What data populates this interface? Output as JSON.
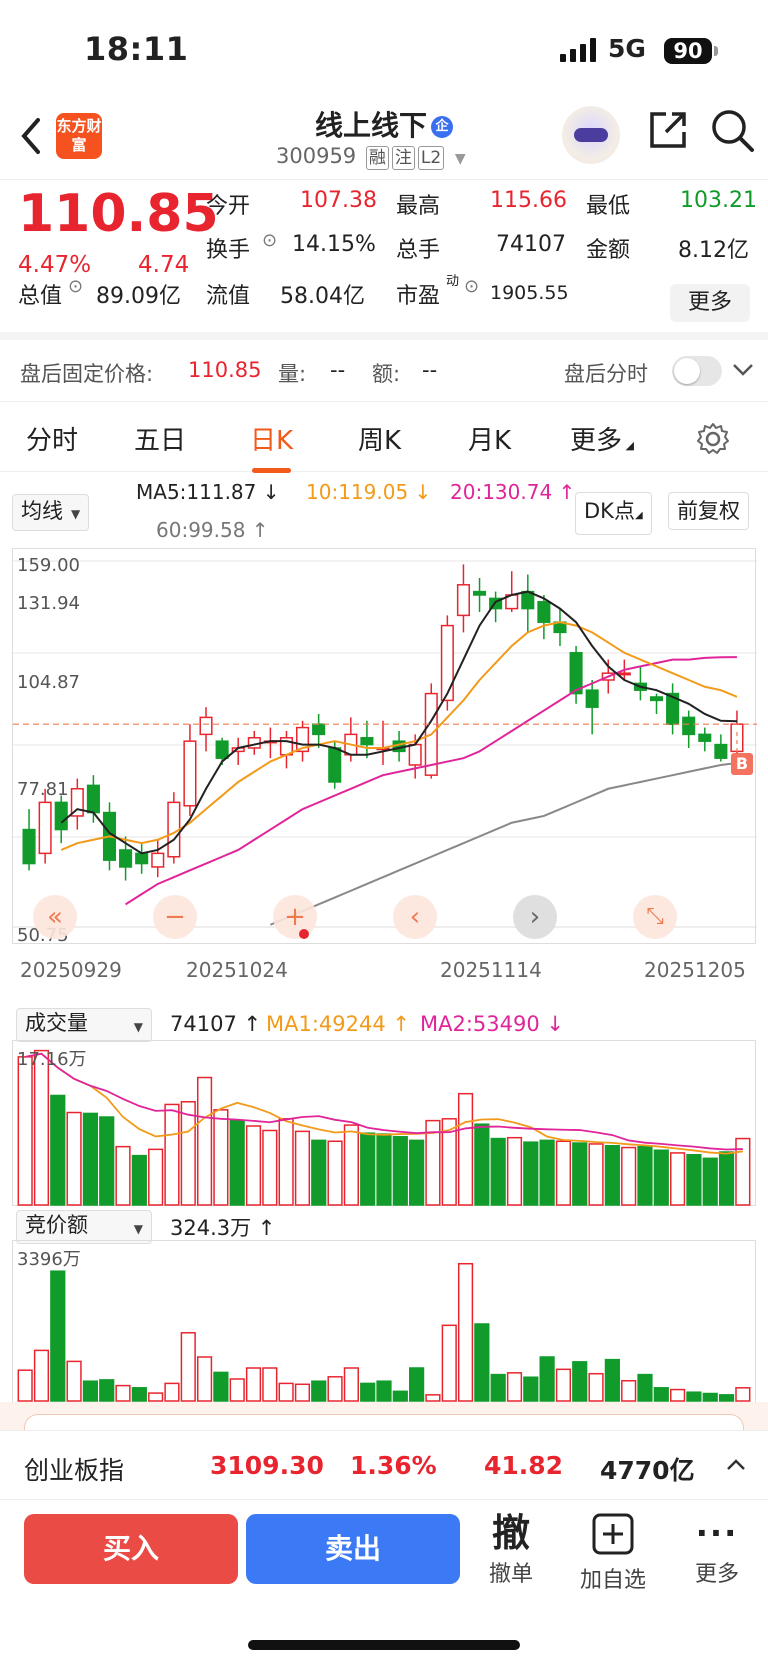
{
  "status_bar": {
    "time": "18:11",
    "network": "5G",
    "battery": "90"
  },
  "header": {
    "logo_text": "东方财富",
    "stock_name": "线上线下",
    "badge": "企",
    "code": "300959",
    "tags": [
      "融",
      "注",
      "L2"
    ]
  },
  "quote": {
    "price": "110.85",
    "change_pct": "4.47%",
    "change_abs": "4.74",
    "open_label": "今开",
    "open": "107.38",
    "high_label": "最高",
    "high": "115.66",
    "low_label": "最低",
    "low": "103.21",
    "turnover_label": "换手",
    "turnover": "14.15%",
    "volume_label": "总手",
    "volume": "74107",
    "amount_label": "金额",
    "amount": "8.12亿",
    "mktcap_label": "总值",
    "mktcap": "89.09亿",
    "float_label": "流值",
    "float_cap": "58.04亿",
    "pe_label": "市盈",
    "pe_sup": "动",
    "pe": "1905.55",
    "more_label": "更多"
  },
  "after_hours": {
    "label": "盘后固定价格:",
    "price": "110.85",
    "vol_label": "量:",
    "vol": "--",
    "amt_label": "额:",
    "amt": "--",
    "toggle_label": "盘后分时"
  },
  "tabs": [
    "分时",
    "五日",
    "日K",
    "周K",
    "月K",
    "更多"
  ],
  "active_tab": "日K",
  "kline": {
    "indicator_select": "均线",
    "ma5": "MA5:111.87",
    "ma10": "10:119.05",
    "ma20": "20:130.74",
    "ma60": "60:99.58",
    "dk_button": "DK点",
    "adjust_button": "前复权",
    "y_labels": [
      "159.00",
      "131.94",
      "104.87",
      "77.81",
      "50.75"
    ],
    "dates": [
      "20250929",
      "20251024",
      "20251114",
      "20251205"
    ],
    "b_marker": "B",
    "colors": {
      "up": "#e8252f",
      "down": "#119b2b",
      "ma5": "#222222",
      "ma10": "#f29a1a",
      "ma20": "#e0259a",
      "ma60": "#888888"
    }
  },
  "chart_data": [
    {
      "type": "candlestick",
      "ylim": [
        50.75,
        159.0
      ],
      "dates_shown": [
        "20250929",
        "20251024",
        "20251114",
        "20251205"
      ],
      "candles": [
        [
          80,
          70,
          86,
          68
        ],
        [
          73,
          88,
          92,
          70
        ],
        [
          88,
          80,
          90,
          76
        ],
        [
          84,
          92,
          95,
          80
        ],
        [
          93,
          85,
          96,
          82
        ],
        [
          85,
          71,
          88,
          68
        ],
        [
          74,
          69,
          78,
          65
        ],
        [
          73,
          70,
          76,
          67
        ],
        [
          69,
          73,
          77,
          66
        ],
        [
          72,
          88,
          91,
          70
        ],
        [
          87,
          106,
          111,
          84
        ],
        [
          108,
          113,
          116,
          103
        ],
        [
          106,
          101,
          107,
          99
        ],
        [
          103,
          104,
          107,
          99
        ],
        [
          104,
          107,
          109,
          102
        ],
        [
          106,
          106,
          110,
          101
        ],
        [
          102,
          107,
          109,
          98
        ],
        [
          103,
          110,
          112,
          100
        ],
        [
          111,
          108,
          114,
          104
        ],
        [
          104,
          94,
          106,
          92
        ],
        [
          102,
          108,
          113,
          100
        ],
        [
          107,
          105,
          112,
          101
        ],
        [
          104,
          104,
          112,
          99
        ],
        [
          106,
          103,
          109,
          100
        ],
        [
          99,
          105,
          108,
          95
        ],
        [
          96,
          120,
          123,
          95
        ],
        [
          118,
          140,
          143,
          115
        ],
        [
          143,
          152,
          158,
          138
        ],
        [
          150,
          149,
          154,
          144
        ],
        [
          148,
          145,
          150,
          141
        ],
        [
          145,
          149,
          156,
          144
        ],
        [
          150,
          145,
          155,
          138
        ],
        [
          147,
          141,
          149,
          136
        ],
        [
          141,
          138,
          145,
          134
        ],
        [
          132,
          120,
          134,
          117
        ],
        [
          121,
          116,
          124,
          108
        ],
        [
          124,
          126,
          130,
          120
        ],
        [
          126,
          126,
          130,
          124
        ],
        [
          123,
          121,
          128,
          118
        ],
        [
          119,
          118,
          120,
          114
        ],
        [
          120,
          111,
          123,
          108
        ],
        [
          113,
          108,
          115,
          104
        ],
        [
          108,
          106,
          110,
          103
        ],
        [
          105,
          101,
          108,
          100
        ],
        [
          103,
          111,
          115,
          97
        ]
      ],
      "ma5": [
        82,
        86,
        85,
        79,
        76,
        73,
        74,
        77,
        83,
        92,
        100,
        104,
        105,
        106,
        106,
        105,
        105,
        104,
        102,
        102,
        103,
        104,
        105,
        112,
        120,
        130,
        140,
        147,
        149,
        150,
        148,
        145,
        141,
        134,
        128,
        124,
        122,
        121,
        119,
        117,
        114,
        112,
        111.87
      ],
      "ma10": [
        74,
        76,
        77,
        78,
        77,
        76,
        77,
        79,
        82,
        86,
        90,
        94,
        97,
        100,
        102,
        104,
        105,
        106,
        105,
        104,
        104,
        105,
        106,
        108,
        113,
        118,
        124,
        129,
        134,
        138,
        140,
        141,
        140,
        138,
        135,
        132,
        130,
        128,
        126,
        124,
        122,
        121,
        119.05
      ],
      "ma20": [
        58,
        61,
        64,
        66,
        68,
        70,
        72,
        74,
        77,
        80,
        83,
        86,
        88,
        90,
        92,
        94,
        96,
        97,
        98,
        99,
        100,
        101,
        103,
        106,
        109,
        112,
        115,
        118,
        121,
        123,
        125,
        127,
        128,
        129,
        130,
        130,
        130.5,
        130.7,
        130.74
      ],
      "ma60": [
        52,
        54,
        56,
        58,
        60,
        62,
        64,
        66,
        68,
        70,
        72,
        74,
        76,
        78,
        80,
        82,
        83,
        84,
        86,
        88,
        90,
        92,
        93,
        94,
        95,
        96,
        97,
        98,
        99,
        99.58
      ]
    },
    {
      "type": "bar",
      "title": "成交量",
      "last": "74107",
      "ma1_label": "MA1:49244",
      "ma2_label": "MA2:53490",
      "y_top_label": "17.16万",
      "values": [
        16.5,
        17.2,
        12.2,
        10.3,
        10.2,
        9.8,
        6.5,
        5.5,
        6.2,
        11.2,
        11.5,
        14.2,
        10.6,
        9.4,
        8.8,
        8.3,
        9.6,
        8.2,
        7.2,
        7.1,
        8.9,
        8.0,
        7.9,
        7.6,
        7.2,
        9.4,
        9.6,
        12.4,
        9.0,
        7.4,
        7.5,
        7.0,
        7.2,
        7.1,
        6.9,
        6.8,
        6.6,
        6.4,
        6.5,
        6.1,
        5.8,
        5.6,
        5.2,
        5.9,
        7.4
      ],
      "up": [
        1,
        1,
        0,
        1,
        0,
        0,
        1,
        0,
        1,
        1,
        1,
        1,
        1,
        0,
        1,
        1,
        1,
        1,
        0,
        1,
        1,
        0,
        0,
        0,
        0,
        1,
        1,
        1,
        0,
        0,
        1,
        0,
        0,
        1,
        0,
        1,
        0,
        1,
        0,
        0,
        1,
        0,
        0,
        0,
        1
      ]
    },
    {
      "type": "bar",
      "title": "竞价额",
      "last": "324.3万",
      "y_top_label": "3396万",
      "values": [
        700,
        1150,
        2950,
        900,
        450,
        480,
        350,
        300,
        180,
        400,
        1550,
        1000,
        650,
        500,
        750,
        750,
        400,
        380,
        450,
        550,
        750,
        400,
        450,
        220,
        750,
        140,
        1720,
        3120,
        1750,
        600,
        640,
        540,
        1000,
        720,
        890,
        620,
        940,
        460,
        600,
        300,
        260,
        200,
        170,
        140,
        300
      ],
      "up": [
        1,
        1,
        0,
        1,
        0,
        0,
        1,
        0,
        1,
        1,
        1,
        1,
        0,
        1,
        1,
        1,
        1,
        1,
        0,
        1,
        1,
        0,
        0,
        0,
        0,
        1,
        1,
        1,
        0,
        0,
        1,
        0,
        0,
        1,
        0,
        1,
        0,
        1,
        0,
        0,
        1,
        0,
        0,
        0,
        1
      ]
    }
  ],
  "volume": {
    "select": "成交量",
    "last": "74107",
    "ma1": "MA1:49244",
    "ma2": "MA2:53490",
    "top": "17.16万"
  },
  "auction": {
    "select": "竞价额",
    "last": "324.3万",
    "top": "3396万"
  },
  "index_bar": {
    "name": "创业板指",
    "value": "3109.30",
    "pct": "1.36%",
    "chg": "41.82",
    "amount": "4770亿"
  },
  "bottom": {
    "buy": "买入",
    "sell": "卖出",
    "cancel_icon": "撤",
    "cancel": "撤单",
    "add": "加自选",
    "more": "更多"
  }
}
